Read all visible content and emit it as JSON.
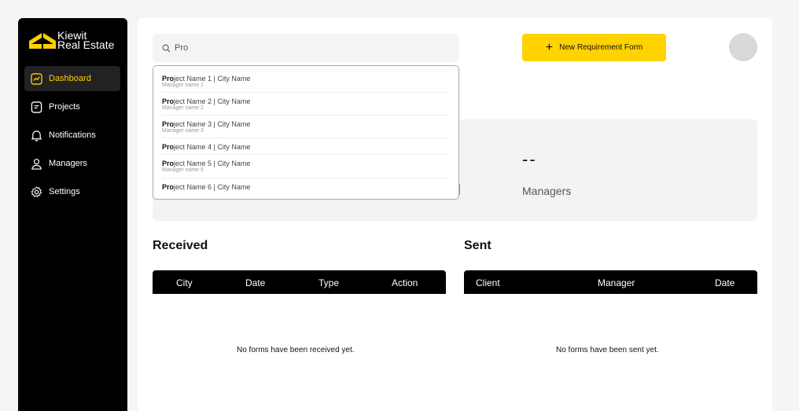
{
  "brand": {
    "line1": "Kiewit",
    "line2": "Real Estate",
    "logo_color": "#ffd200"
  },
  "sidebar": {
    "items": [
      {
        "label": "Dashboard",
        "icon": "chart-icon",
        "active": true
      },
      {
        "label": "Projects",
        "icon": "document-icon"
      },
      {
        "label": "Notifications",
        "icon": "bell-icon"
      },
      {
        "label": "Managers",
        "icon": "user-icon"
      },
      {
        "label": "Settings",
        "icon": "gear-icon"
      }
    ]
  },
  "search": {
    "value": "Pro",
    "icon": "search-icon"
  },
  "dropdown": {
    "items": [
      {
        "match": "Pro",
        "rest": "ject Name 1 | City Name",
        "sub": "Manager name 1"
      },
      {
        "match": "Pro",
        "rest": "ject Name 2 | City Name",
        "sub": "Manager name 2"
      },
      {
        "match": "Pro",
        "rest": "ject Name 3 | City Name",
        "sub": "Manager name 3"
      },
      {
        "match": "Pro",
        "rest": "ject Name 4 | City Name",
        "sub": ""
      },
      {
        "match": "Pro",
        "rest": "ject Name 5 | City Name",
        "sub": "Manager name 5"
      },
      {
        "match": "Pro",
        "rest": "ject Name 6 | City Name",
        "sub": ""
      }
    ]
  },
  "header": {
    "new_button_label": "New Requirement Form",
    "accent": "#ffd200"
  },
  "stats": {
    "managers_value": "--",
    "managers_label": "Managers"
  },
  "received": {
    "title": "Received",
    "columns": [
      "City",
      "Date",
      "Type",
      "Action"
    ],
    "empty_text": "No forms have been received yet."
  },
  "sent": {
    "title": "Sent",
    "columns": [
      "Client",
      "Manager",
      "Date"
    ],
    "empty_text": "No forms have been sent yet."
  }
}
